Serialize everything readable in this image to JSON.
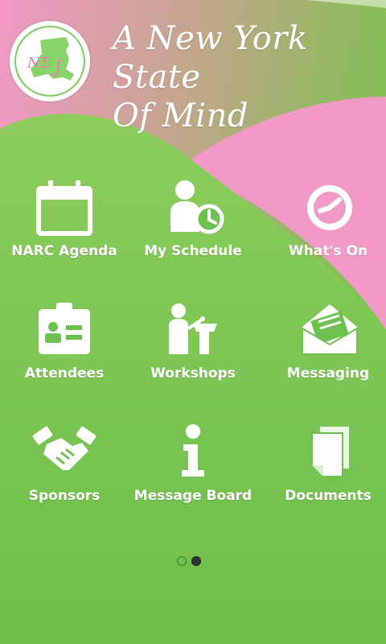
{
  "header": {
    "title_line1": "A New York State",
    "title_line2": "Of Mind",
    "logo_icon": "new-york-state-logo"
  },
  "menu": [
    {
      "label": "NARC Agenda",
      "icon": "calendar-icon"
    },
    {
      "label": "My Schedule",
      "icon": "person-clock-icon"
    },
    {
      "label": "What's On",
      "icon": "clock-icon"
    },
    {
      "label": "Attendees",
      "icon": "id-badge-icon"
    },
    {
      "label": "Workshops",
      "icon": "speaker-podium-icon"
    },
    {
      "label": "Messaging",
      "icon": "envelope-icon"
    },
    {
      "label": "Sponsors",
      "icon": "handshake-icon"
    },
    {
      "label": "Message Board",
      "icon": "info-icon"
    },
    {
      "label": "Documents",
      "icon": "documents-icon"
    }
  ],
  "pager": {
    "active_index": 0,
    "count": 2
  },
  "colors": {
    "green": "#6dc24f",
    "light_green": "#8cd264",
    "pink": "#f29ac6",
    "white": "#ffffff",
    "dot_active": "#6dc24f",
    "dot_inactive": "#333333"
  }
}
